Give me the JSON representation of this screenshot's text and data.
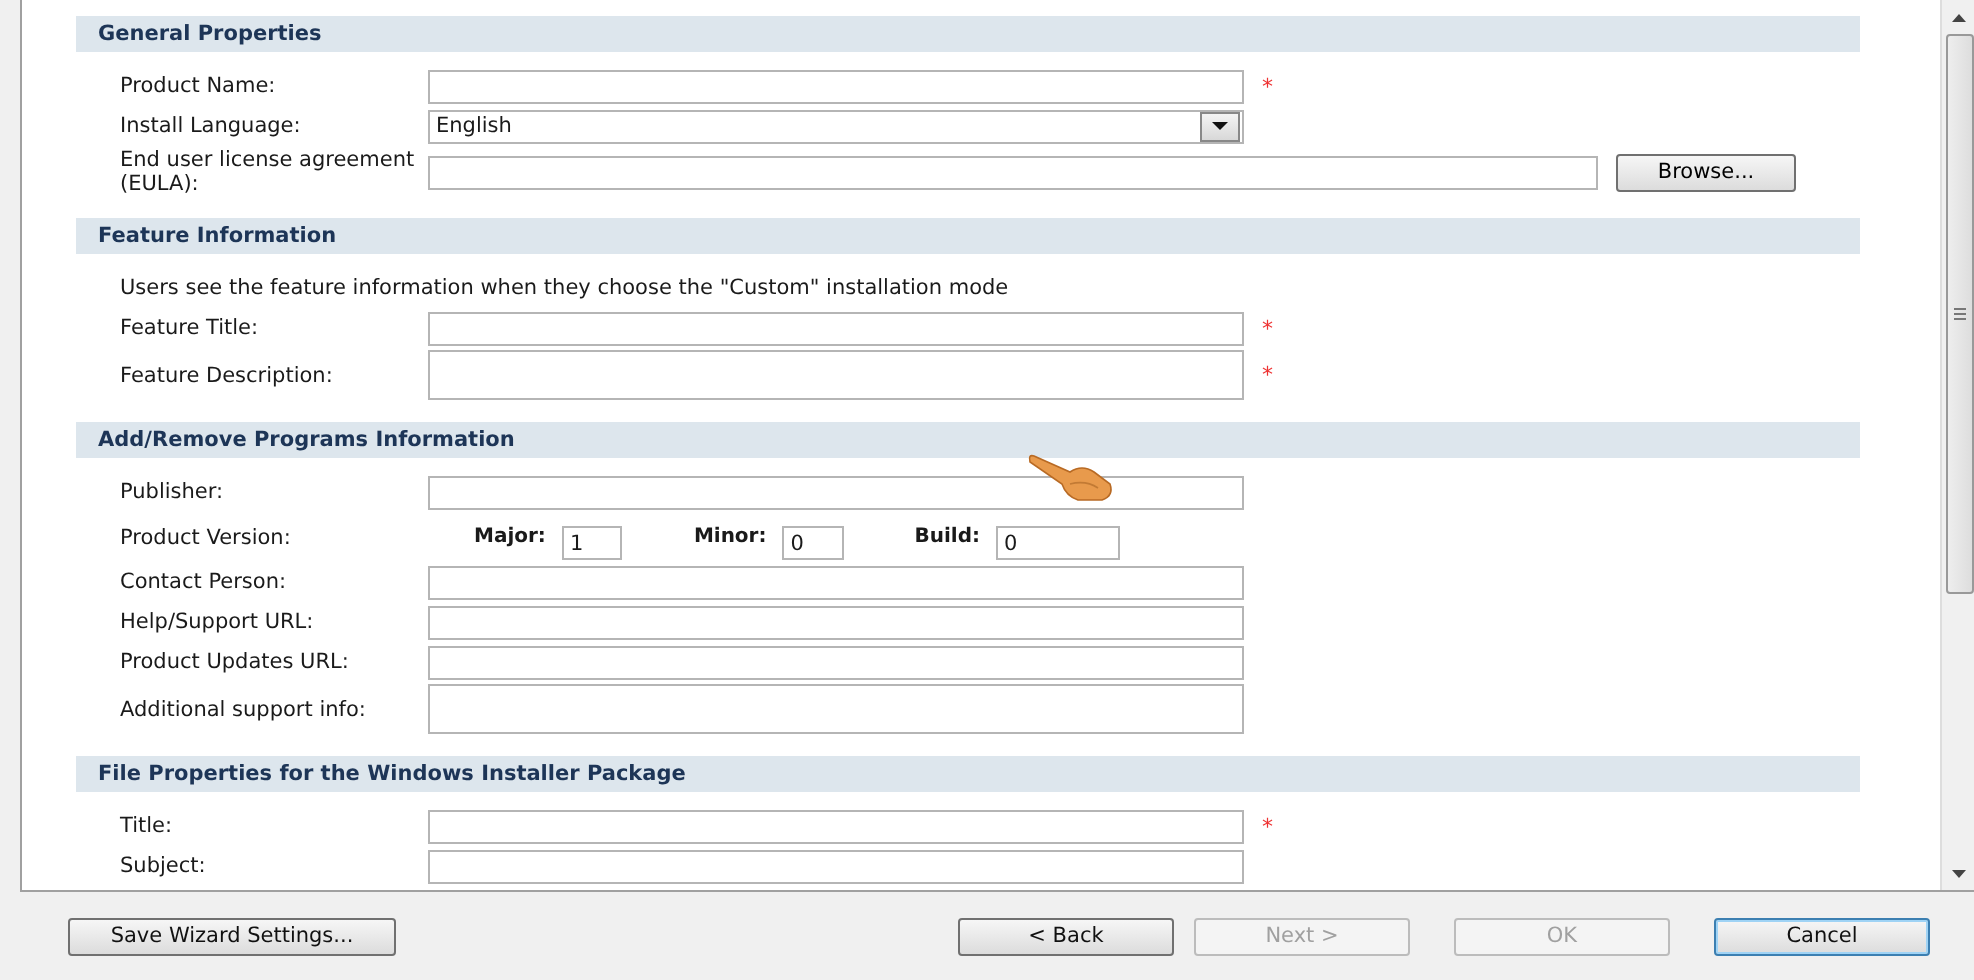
{
  "sections": [
    {
      "title": "General Properties",
      "rows": [
        {
          "kind": "text",
          "label": "Product Name:",
          "mark": "*"
        },
        {
          "kind": "select",
          "label": "Install Language:",
          "value": "English"
        },
        {
          "kind": "file",
          "label": "End user license agreement (EULA):",
          "button": "Browse..."
        }
      ]
    },
    {
      "title": "Feature Information",
      "rows": [
        {
          "kind": "note",
          "text": "Users see the feature information when they choose the \"Custom\" installation mode"
        },
        {
          "kind": "text",
          "label": "Feature Title:",
          "mark": "*"
        },
        {
          "kind": "textarea",
          "label": "Feature Description:",
          "mark": "*"
        }
      ]
    },
    {
      "title": "Add/Remove Programs Information",
      "rows": [
        {
          "kind": "text",
          "label": "Publisher:"
        },
        {
          "kind": "version",
          "label": "Product Version:",
          "parts": [
            {
              "label": "Major:",
              "value": "1"
            },
            {
              "label": "Minor:",
              "value": "0"
            },
            {
              "label": "Build:",
              "value": "0"
            }
          ]
        },
        {
          "kind": "text",
          "label": "Contact Person:"
        },
        {
          "kind": "text",
          "label": "Help/Support URL:"
        },
        {
          "kind": "text",
          "label": "Product Updates URL:"
        },
        {
          "kind": "textarea",
          "label": "Additional support info:"
        }
      ]
    },
    {
      "title": "File Properties for the Windows Installer Package",
      "rows": [
        {
          "kind": "text",
          "label": "Title:",
          "mark": "*"
        },
        {
          "kind": "text",
          "label": "Subject:"
        }
      ]
    }
  ],
  "footer": {
    "left_buttons": [
      {
        "label": "Save Wizard Settings...",
        "disabled": false,
        "focused": false
      }
    ],
    "right_buttons": [
      {
        "label": "< Back",
        "disabled": false,
        "focused": false
      },
      {
        "label": "Next >",
        "disabled": true,
        "focused": false
      },
      {
        "label": "OK",
        "disabled": true,
        "focused": false
      },
      {
        "label": "Cancel",
        "disabled": false,
        "focused": true
      }
    ]
  }
}
